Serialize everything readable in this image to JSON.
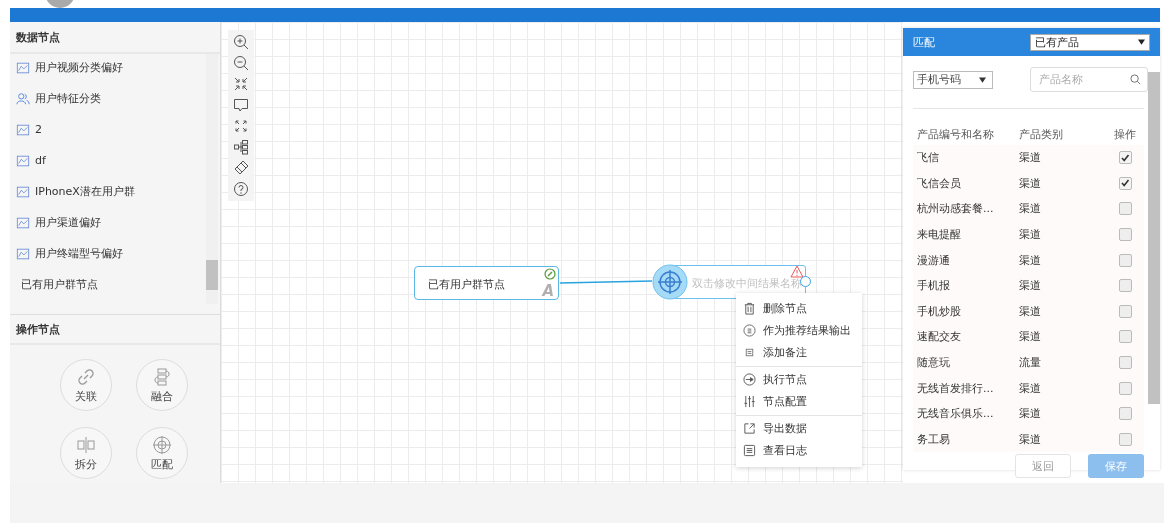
{
  "data_nodes": {
    "title": "数据节点",
    "items": [
      {
        "label": "用户视频分类偏好",
        "kind": "group"
      },
      {
        "label": "用户特征分类",
        "kind": "users"
      },
      {
        "label": "2",
        "kind": "group"
      },
      {
        "label": "df",
        "kind": "group"
      },
      {
        "label": "IPhoneX潜在用户群",
        "kind": "group"
      },
      {
        "label": "用户渠道偏好",
        "kind": "group"
      },
      {
        "label": "用户终端型号偏好",
        "kind": "group"
      },
      {
        "label": "已有用户群节点",
        "kind": "plain"
      }
    ]
  },
  "operation_nodes": {
    "title": "操作节点",
    "items": [
      {
        "label": "关联",
        "kind": "link"
      },
      {
        "label": "融合",
        "kind": "merge"
      },
      {
        "label": "拆分",
        "kind": "split"
      },
      {
        "label": "匹配",
        "kind": "match"
      }
    ]
  },
  "canvas": {
    "source_node": {
      "label": "已有用户群节点",
      "badge": "A"
    },
    "match_node": {
      "placeholder": "双击修改中间结果名称",
      "warning": true
    },
    "context_menu": [
      [
        {
          "label": "删除节点",
          "kind": "trash"
        },
        {
          "label": "作为推荐结果输出",
          "kind": "circle"
        },
        {
          "label": "添加备注",
          "kind": "note"
        }
      ],
      [
        {
          "label": "执行节点",
          "kind": "run"
        },
        {
          "label": "节点配置",
          "kind": "sliders"
        }
      ],
      [
        {
          "label": "导出数据",
          "kind": "export"
        },
        {
          "label": "查看日志",
          "kind": "log"
        }
      ]
    ]
  },
  "match_panel": {
    "title": "匹配",
    "source_select": "已有产品",
    "key_select": "手机号码",
    "search": {
      "placeholder": "产品名称"
    },
    "columns": [
      "产品编号和名称",
      "产品类别",
      "操作"
    ],
    "rows": [
      {
        "name": "飞信",
        "category": "渠道",
        "checked": true
      },
      {
        "name": "飞信会员",
        "category": "渠道",
        "checked": true
      },
      {
        "name": "杭州动感套餐...",
        "category": "渠道",
        "checked": false
      },
      {
        "name": "来电提醒",
        "category": "渠道",
        "checked": false
      },
      {
        "name": "漫游通",
        "category": "渠道",
        "checked": false
      },
      {
        "name": "手机报",
        "category": "渠道",
        "checked": false
      },
      {
        "name": "手机炒股",
        "category": "渠道",
        "checked": false
      },
      {
        "name": "速配交友",
        "category": "渠道",
        "checked": false
      },
      {
        "name": "随意玩",
        "category": "流量",
        "checked": false
      },
      {
        "name": "无线首发排行...",
        "category": "渠道",
        "checked": false
      },
      {
        "name": "无线音乐俱乐...",
        "category": "渠道",
        "checked": false
      },
      {
        "name": "务工易",
        "category": "渠道",
        "checked": false
      }
    ],
    "buttons": [
      "返回",
      "保存"
    ]
  }
}
